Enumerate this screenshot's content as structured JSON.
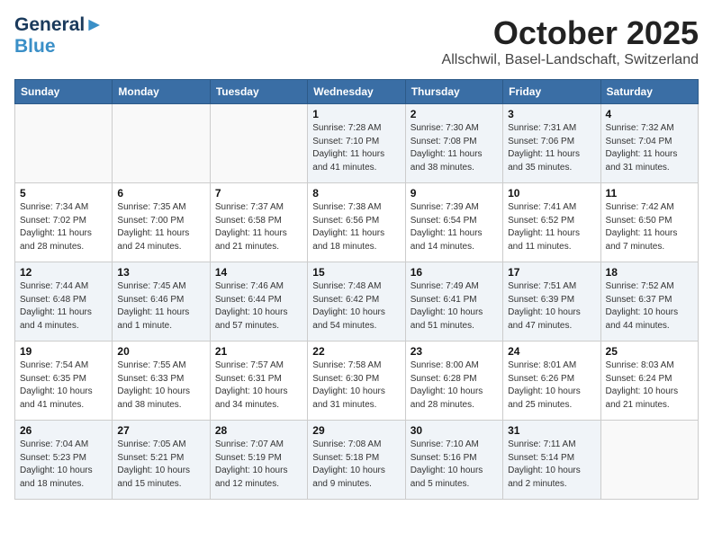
{
  "header": {
    "logo_line1": "General",
    "logo_line2": "Blue",
    "month": "October 2025",
    "location": "Allschwil, Basel-Landschaft, Switzerland"
  },
  "weekdays": [
    "Sunday",
    "Monday",
    "Tuesday",
    "Wednesday",
    "Thursday",
    "Friday",
    "Saturday"
  ],
  "weeks": [
    [
      {
        "day": "",
        "info": ""
      },
      {
        "day": "",
        "info": ""
      },
      {
        "day": "",
        "info": ""
      },
      {
        "day": "1",
        "info": "Sunrise: 7:28 AM\nSunset: 7:10 PM\nDaylight: 11 hours\nand 41 minutes."
      },
      {
        "day": "2",
        "info": "Sunrise: 7:30 AM\nSunset: 7:08 PM\nDaylight: 11 hours\nand 38 minutes."
      },
      {
        "day": "3",
        "info": "Sunrise: 7:31 AM\nSunset: 7:06 PM\nDaylight: 11 hours\nand 35 minutes."
      },
      {
        "day": "4",
        "info": "Sunrise: 7:32 AM\nSunset: 7:04 PM\nDaylight: 11 hours\nand 31 minutes."
      }
    ],
    [
      {
        "day": "5",
        "info": "Sunrise: 7:34 AM\nSunset: 7:02 PM\nDaylight: 11 hours\nand 28 minutes."
      },
      {
        "day": "6",
        "info": "Sunrise: 7:35 AM\nSunset: 7:00 PM\nDaylight: 11 hours\nand 24 minutes."
      },
      {
        "day": "7",
        "info": "Sunrise: 7:37 AM\nSunset: 6:58 PM\nDaylight: 11 hours\nand 21 minutes."
      },
      {
        "day": "8",
        "info": "Sunrise: 7:38 AM\nSunset: 6:56 PM\nDaylight: 11 hours\nand 18 minutes."
      },
      {
        "day": "9",
        "info": "Sunrise: 7:39 AM\nSunset: 6:54 PM\nDaylight: 11 hours\nand 14 minutes."
      },
      {
        "day": "10",
        "info": "Sunrise: 7:41 AM\nSunset: 6:52 PM\nDaylight: 11 hours\nand 11 minutes."
      },
      {
        "day": "11",
        "info": "Sunrise: 7:42 AM\nSunset: 6:50 PM\nDaylight: 11 hours\nand 7 minutes."
      }
    ],
    [
      {
        "day": "12",
        "info": "Sunrise: 7:44 AM\nSunset: 6:48 PM\nDaylight: 11 hours\nand 4 minutes."
      },
      {
        "day": "13",
        "info": "Sunrise: 7:45 AM\nSunset: 6:46 PM\nDaylight: 11 hours\nand 1 minute."
      },
      {
        "day": "14",
        "info": "Sunrise: 7:46 AM\nSunset: 6:44 PM\nDaylight: 10 hours\nand 57 minutes."
      },
      {
        "day": "15",
        "info": "Sunrise: 7:48 AM\nSunset: 6:42 PM\nDaylight: 10 hours\nand 54 minutes."
      },
      {
        "day": "16",
        "info": "Sunrise: 7:49 AM\nSunset: 6:41 PM\nDaylight: 10 hours\nand 51 minutes."
      },
      {
        "day": "17",
        "info": "Sunrise: 7:51 AM\nSunset: 6:39 PM\nDaylight: 10 hours\nand 47 minutes."
      },
      {
        "day": "18",
        "info": "Sunrise: 7:52 AM\nSunset: 6:37 PM\nDaylight: 10 hours\nand 44 minutes."
      }
    ],
    [
      {
        "day": "19",
        "info": "Sunrise: 7:54 AM\nSunset: 6:35 PM\nDaylight: 10 hours\nand 41 minutes."
      },
      {
        "day": "20",
        "info": "Sunrise: 7:55 AM\nSunset: 6:33 PM\nDaylight: 10 hours\nand 38 minutes."
      },
      {
        "day": "21",
        "info": "Sunrise: 7:57 AM\nSunset: 6:31 PM\nDaylight: 10 hours\nand 34 minutes."
      },
      {
        "day": "22",
        "info": "Sunrise: 7:58 AM\nSunset: 6:30 PM\nDaylight: 10 hours\nand 31 minutes."
      },
      {
        "day": "23",
        "info": "Sunrise: 8:00 AM\nSunset: 6:28 PM\nDaylight: 10 hours\nand 28 minutes."
      },
      {
        "day": "24",
        "info": "Sunrise: 8:01 AM\nSunset: 6:26 PM\nDaylight: 10 hours\nand 25 minutes."
      },
      {
        "day": "25",
        "info": "Sunrise: 8:03 AM\nSunset: 6:24 PM\nDaylight: 10 hours\nand 21 minutes."
      }
    ],
    [
      {
        "day": "26",
        "info": "Sunrise: 7:04 AM\nSunset: 5:23 PM\nDaylight: 10 hours\nand 18 minutes."
      },
      {
        "day": "27",
        "info": "Sunrise: 7:05 AM\nSunset: 5:21 PM\nDaylight: 10 hours\nand 15 minutes."
      },
      {
        "day": "28",
        "info": "Sunrise: 7:07 AM\nSunset: 5:19 PM\nDaylight: 10 hours\nand 12 minutes."
      },
      {
        "day": "29",
        "info": "Sunrise: 7:08 AM\nSunset: 5:18 PM\nDaylight: 10 hours\nand 9 minutes."
      },
      {
        "day": "30",
        "info": "Sunrise: 7:10 AM\nSunset: 5:16 PM\nDaylight: 10 hours\nand 5 minutes."
      },
      {
        "day": "31",
        "info": "Sunrise: 7:11 AM\nSunset: 5:14 PM\nDaylight: 10 hours\nand 2 minutes."
      },
      {
        "day": "",
        "info": ""
      }
    ]
  ]
}
